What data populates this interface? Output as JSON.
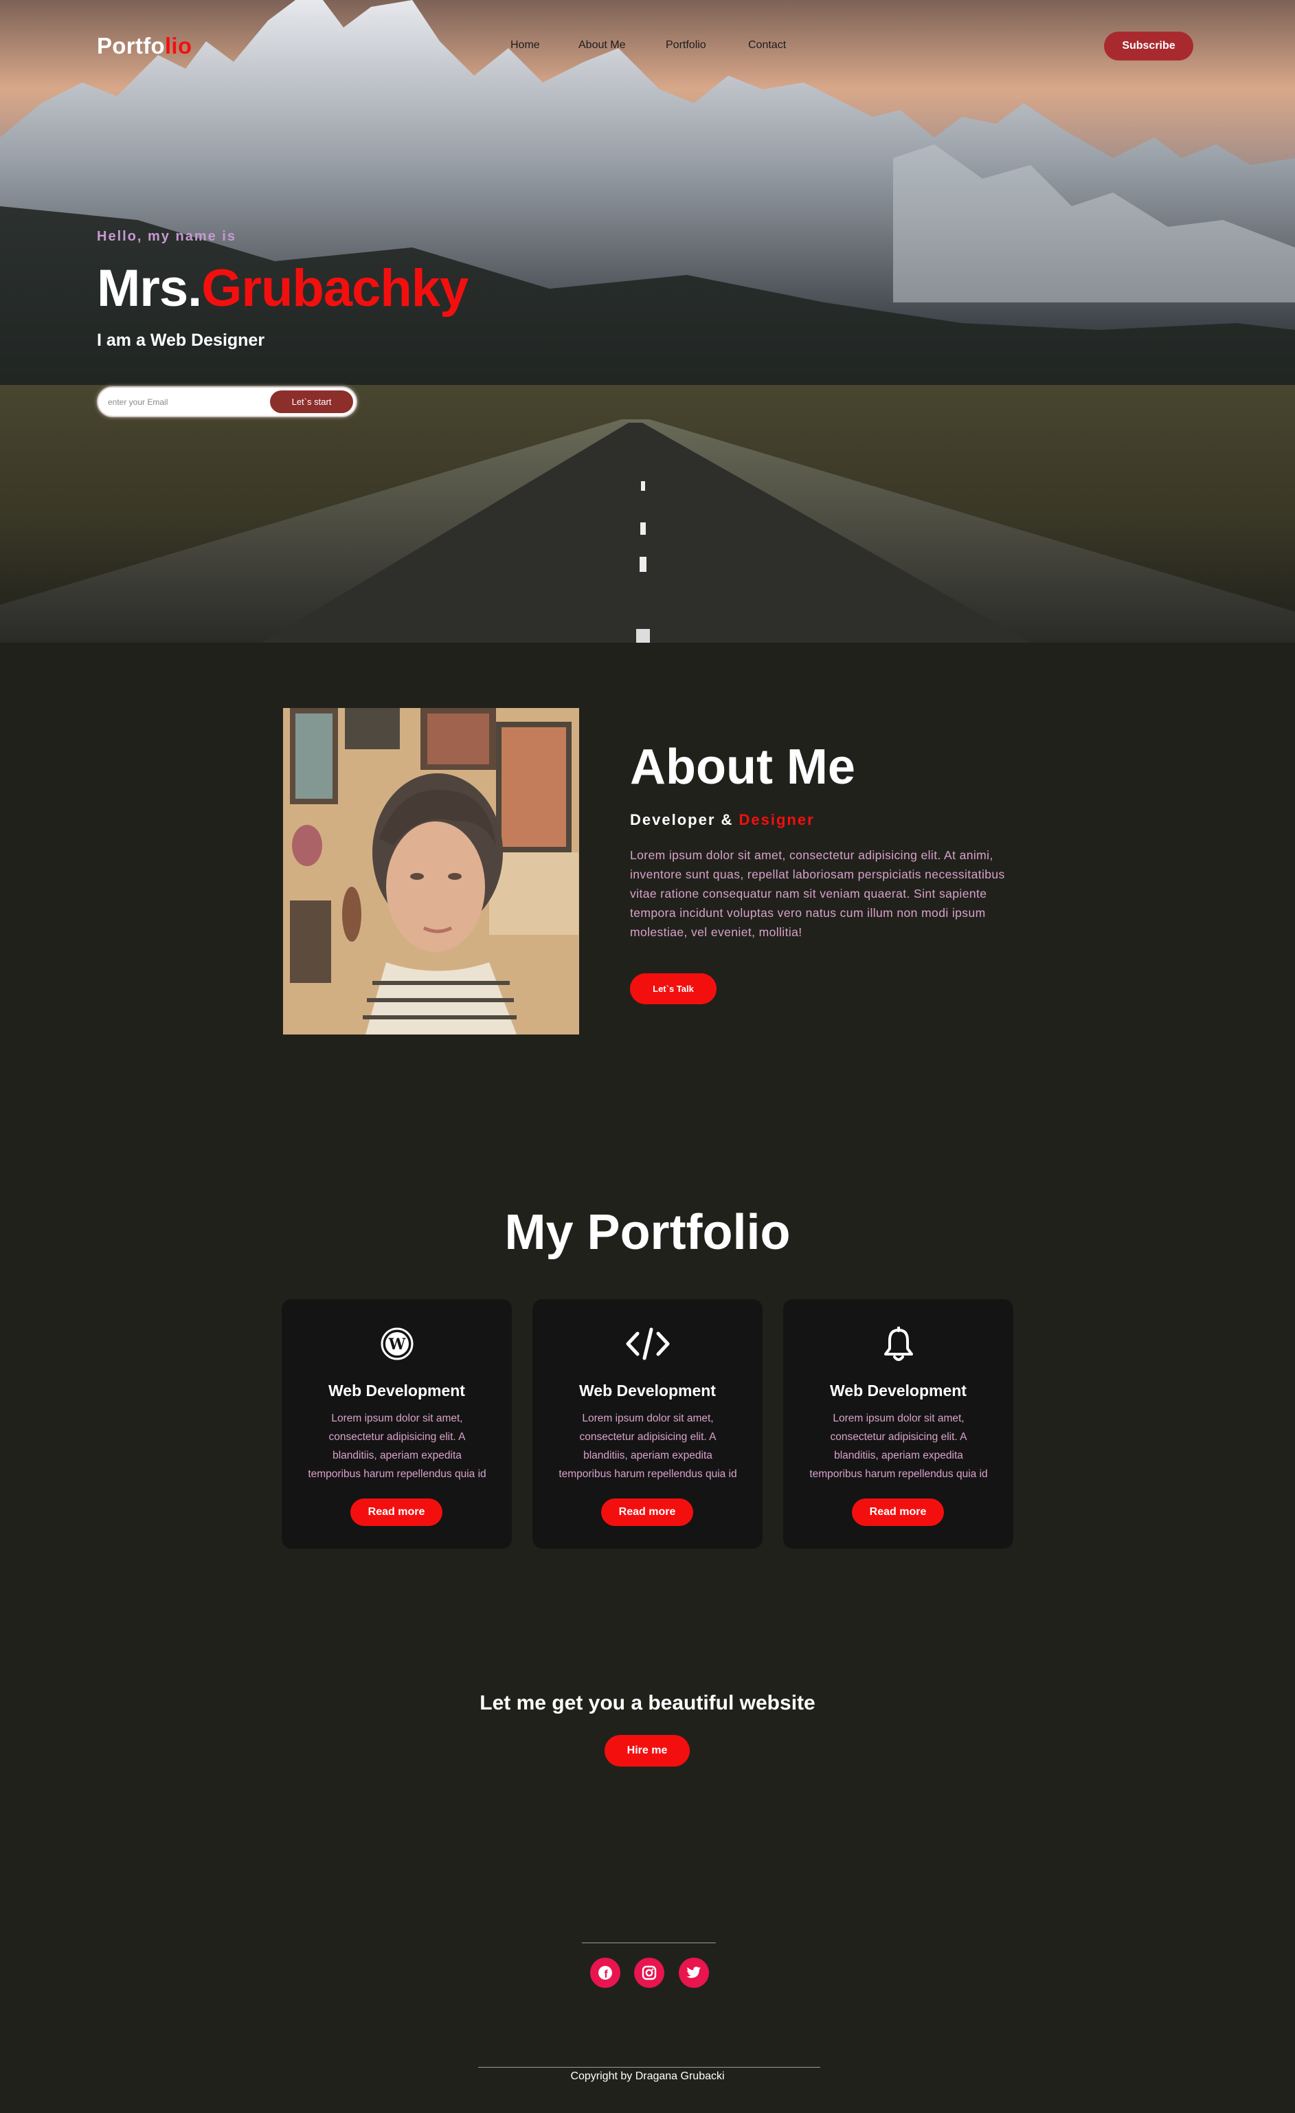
{
  "header": {
    "logo_main": "Portfo",
    "logo_accent": "lio",
    "nav": [
      "Home",
      "About Me",
      "Portfolio",
      "Contact"
    ],
    "subscribe_label": "Subscribe"
  },
  "hero": {
    "greeting": "Hello, my name is",
    "name_prefix": "Mrs.",
    "name_accent": "Grubachky",
    "role": "I am a Web Designer",
    "email_placeholder": "enter your Email",
    "start_label": "Let`s start"
  },
  "about": {
    "title": "About Me",
    "subtitle_main": "Developer & ",
    "subtitle_accent": "Designer",
    "text": "Lorem ipsum dolor sit amet, consectetur adipisicing elit. At animi, inventore sunt quas, repellat laboriosam perspiciatis necessitatibus vitae ratione consequatur nam sit veniam quaerat. Sint sapiente tempora incidunt voluptas vero natus cum illum non modi ipsum molestiae, vel eveniet, mollitia!",
    "talk_label": "Let`s Talk"
  },
  "portfolio": {
    "title": "My Portfolio",
    "cards": [
      {
        "icon": "wordpress-icon",
        "title": "Web Development",
        "text": "Lorem ipsum dolor sit amet, consectetur adipisicing elit. A blanditiis, aperiam expedita temporibus harum repellendus quia id",
        "button": "Read more"
      },
      {
        "icon": "code-icon",
        "title": "Web Development",
        "text": "Lorem ipsum dolor sit amet, consectetur adipisicing elit. A blanditiis, aperiam expedita temporibus harum repellendus quia id",
        "button": "Read more"
      },
      {
        "icon": "bell-icon",
        "title": "Web Development",
        "text": "Lorem ipsum dolor sit amet, consectetur adipisicing elit. A blanditiis, aperiam expedita temporibus harum repellendus quia id",
        "button": "Read more"
      }
    ]
  },
  "hire": {
    "text": "Let me get you a beautiful website",
    "button": "Hire me"
  },
  "footer": {
    "social": [
      "facebook-icon",
      "instagram-icon",
      "twitter-icon"
    ],
    "copyright": "Copyright by Dragana Grubacki"
  },
  "colors": {
    "accent": "#f40f0f",
    "background": "#21211c",
    "card": "#141414",
    "text_pink": "#d8a2c9",
    "social": "#e8154f"
  }
}
